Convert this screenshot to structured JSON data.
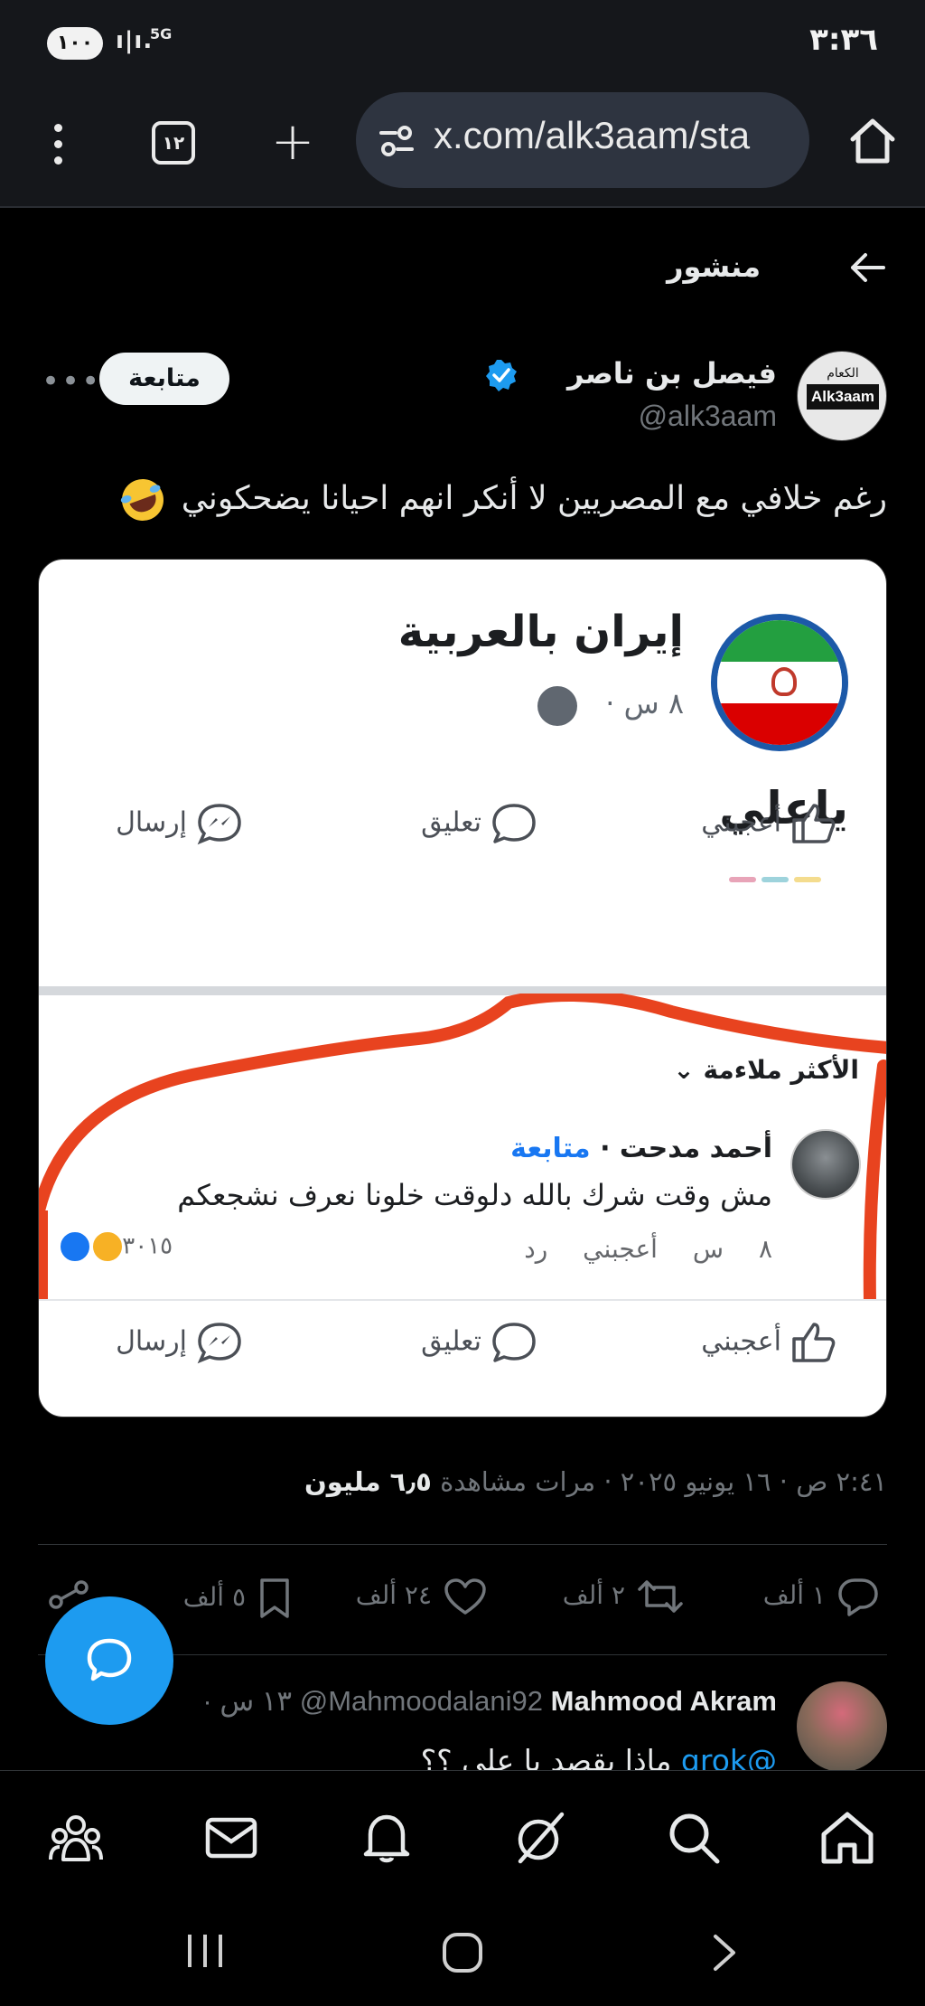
{
  "status_bar": {
    "battery": "١٠٠",
    "network": "5G",
    "time": "٣:٣٦"
  },
  "browser": {
    "tab_count": "١٢",
    "url": "x.com/alk3aam/sta"
  },
  "post_header": {
    "title": "منشور"
  },
  "author": {
    "name": "فيصل بن ناصر",
    "handle": "@alk3aam",
    "follow_label": "متابعة",
    "avatar_logo_text": "Alk3aam",
    "avatar_logo_ar": "الكعام"
  },
  "tweet": {
    "text": "رغم خلافي مع المصريين لا أنكر انهم احيانا يضحكوني"
  },
  "media": {
    "page_name": "إيران بالعربية",
    "page_meta": "٨ س ·",
    "post_text": "ياعلي",
    "actions": {
      "like": "أعجبني",
      "comment": "تعليق",
      "send": "إرسال"
    },
    "relevance_label": "الأكثر ملاءمة",
    "comment": {
      "author": "أحمد مدحت",
      "follow": "متابعة",
      "text": "مش وقت شرك بالله دلوقت خلونا نعرف نشجعكم",
      "time": "٨ س",
      "like": "أعجبني",
      "reply": "رد",
      "reaction_count": "٣٠١٥"
    }
  },
  "timestamp": {
    "text": "٢:٤١ ص · ١٦ يونيو ٢٠٢٥ · ",
    "views": "٦٫٥ مليون",
    "views_label": "مرات مشاهدة"
  },
  "engagement": {
    "replies": "١ ألف",
    "reposts": "٢ ألف",
    "likes": "٢٤ ألف",
    "bookmarks": "٥ ألف"
  },
  "reply": {
    "name": "Mahmood Akram",
    "handle": "@Mahmoodalani92",
    "time": "· ١٣ س",
    "mention": "@grok",
    "text": "ماذا يقصد يا علي ؟؟"
  },
  "colors": {
    "accent": "#1d9bf0",
    "background": "#000000",
    "muted": "#71767b",
    "fb_blue": "#1877f2",
    "highlight_red": "#e8431f"
  }
}
